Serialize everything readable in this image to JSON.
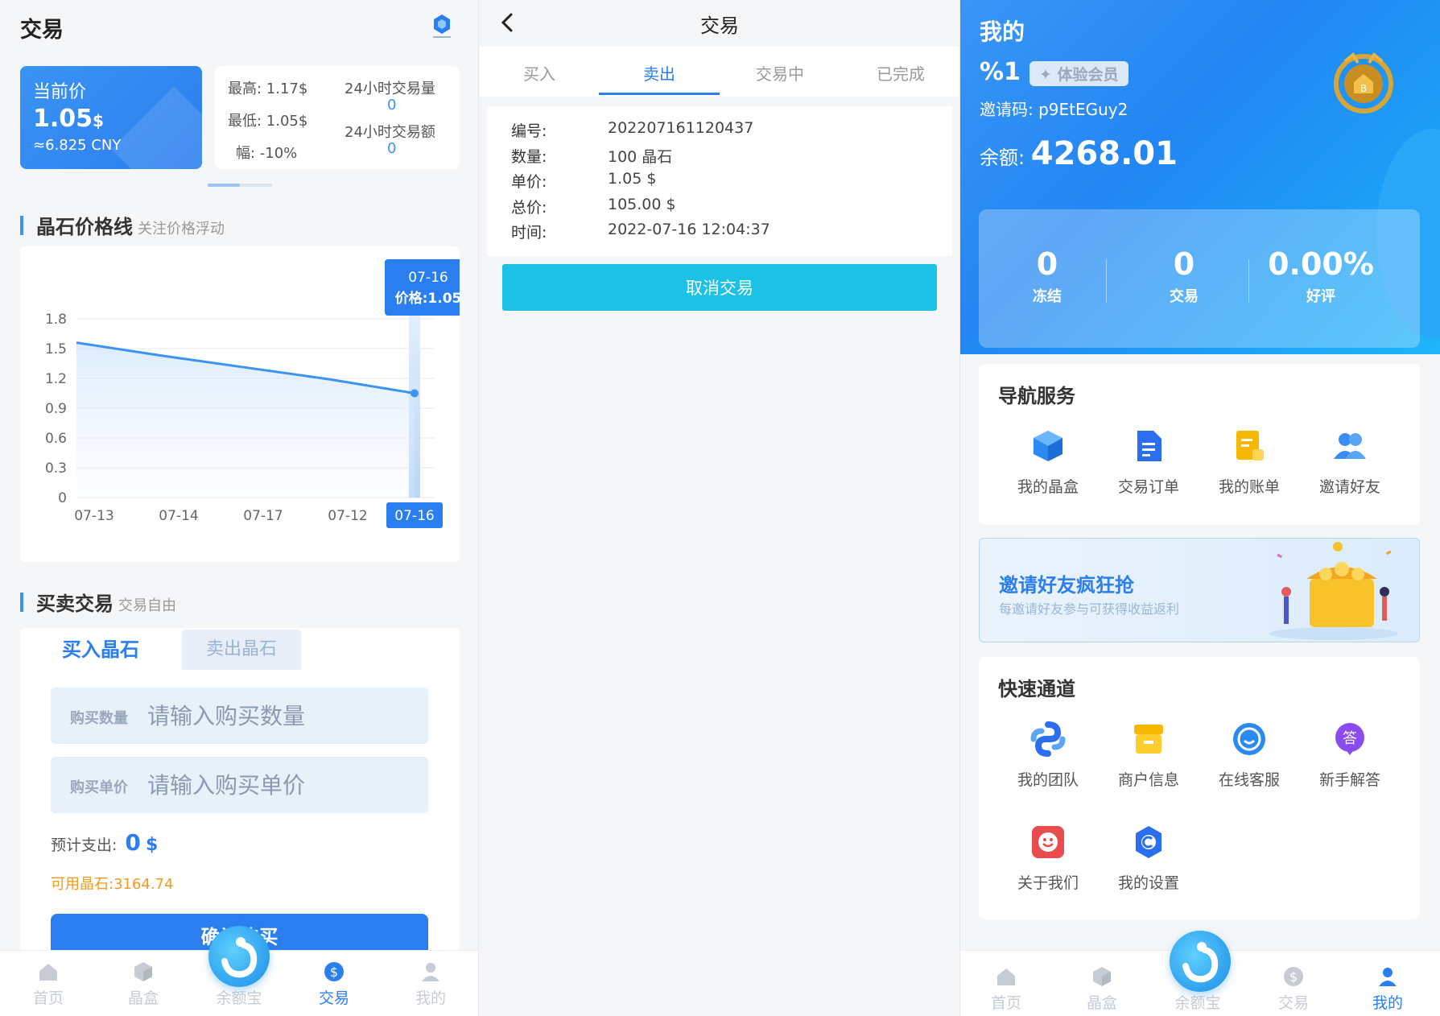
{
  "colors": {
    "accent": "#2b7ef0",
    "orange": "#f39a1e",
    "cyan": "#1dc1e6"
  },
  "panel1": {
    "title": "交易",
    "price_card": {
      "label": "当前价",
      "value": "1.05",
      "unit": "$",
      "cny": "≈6.825 CNY"
    },
    "stats": {
      "high": "最高: 1.17$",
      "low": "最低: 1.05$",
      "change": "幅: -10%",
      "vol24_label": "24小时交易量",
      "vol24_value": "0",
      "amt24_label": "24小时交易额",
      "amt24_value": "0"
    },
    "price_section": {
      "title": "晶石价格线",
      "subtitle": "关注价格浮动"
    },
    "chart_tooltip": {
      "date": "07-16",
      "price_label": "价格:1.05"
    },
    "chart_data": {
      "type": "line",
      "categories": [
        "07-13",
        "07-14",
        "07-17",
        "07-12",
        "07-16"
      ],
      "values": [
        1.56,
        1.43,
        1.31,
        1.19,
        1.05
      ],
      "yticks": [
        "0",
        "0.3",
        "0.6",
        "0.9",
        "1.2",
        "1.5",
        "1.8"
      ],
      "ylim": [
        0,
        1.8
      ],
      "highlight_index": 4,
      "grid": true
    },
    "trade_section": {
      "title": "买卖交易",
      "subtitle": "交易自由"
    },
    "tabs": {
      "buy": "买入晶石",
      "sell": "卖出晶石"
    },
    "qty": {
      "label": "购买数量",
      "placeholder": "请输入购买数量"
    },
    "unit_price": {
      "label": "购买单价",
      "placeholder": "请输入购买单价"
    },
    "estimate": {
      "label": "预计支出:",
      "value": "0",
      "unit": "$"
    },
    "available": "可用晶石:3164.74",
    "confirm": "确认购买",
    "tabbar": [
      "首页",
      "晶盒",
      "余额宝",
      "交易",
      "我的"
    ]
  },
  "panel2": {
    "title": "交易",
    "tabs": [
      "买入",
      "卖出",
      "交易中",
      "已完成"
    ],
    "active_tab": 1,
    "order": {
      "id_label": "编号:",
      "id": "202207161120437",
      "qty_label": "数量:",
      "qty": "100 晶石",
      "price_label": "单价:",
      "price": "1.05 $",
      "total_label": "总价:",
      "total": "105.00 $",
      "time_label": "时间:",
      "time": "2022-07-16 12:04:37"
    },
    "cancel": "取消交易"
  },
  "panel3": {
    "title": "我的",
    "uid": "%1",
    "badge": "✦ 体验会员",
    "invite_code": "邀请码:  p9EtEGuy2",
    "balance_label": "余额:",
    "balance": "4268.01",
    "stats": [
      {
        "num": "0",
        "label": "冻结"
      },
      {
        "num": "0",
        "label": "交易"
      },
      {
        "num": "0.00%",
        "label": "好评"
      }
    ],
    "nav": {
      "title": "导航服务",
      "items": [
        "我的晶盒",
        "交易订单",
        "我的账单",
        "邀请好友"
      ]
    },
    "banner": {
      "title": "邀请好友疯狂抢",
      "subtitle": "每邀请好友参与可获得收益返利"
    },
    "quick": {
      "title": "快速通道",
      "items": [
        "我的团队",
        "商户信息",
        "在线客服",
        "新手解答",
        "关于我们",
        "我的设置"
      ]
    },
    "tabbar": [
      "首页",
      "晶盒",
      "余额宝",
      "交易",
      "我的"
    ]
  }
}
